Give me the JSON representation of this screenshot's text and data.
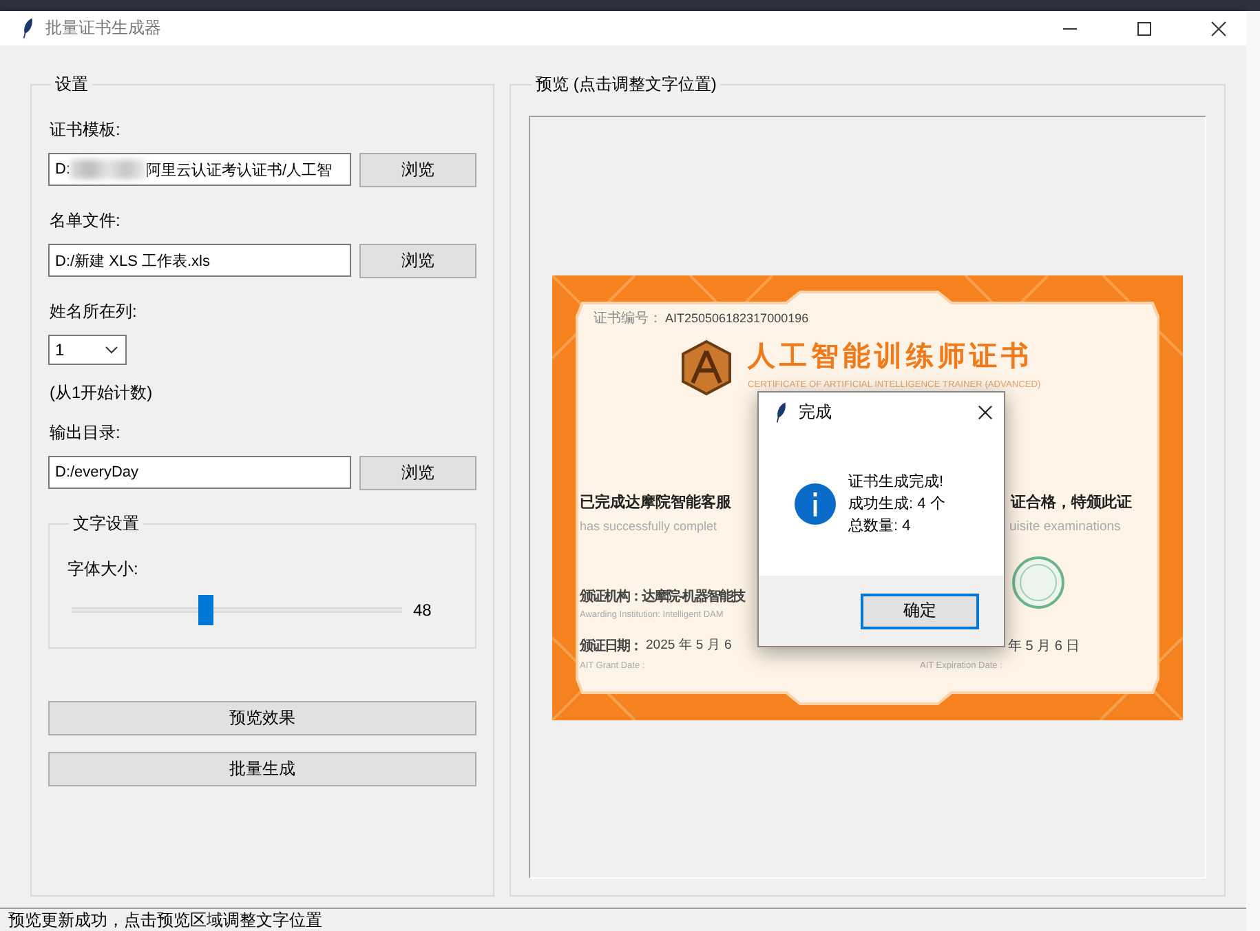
{
  "window": {
    "title": "批量证书生成器"
  },
  "settings": {
    "title": "设置",
    "fields": [
      {
        "kind": "path",
        "label": "证书模板:",
        "value": "D:",
        "value_after_redaction": "阿里云认证考认证书/人工智",
        "button": "浏览"
      },
      {
        "kind": "path",
        "label": "名单文件:",
        "value": "D:/新建 XLS 工作表.xls",
        "button": "浏览"
      },
      {
        "kind": "combo",
        "label": "姓名所在列:",
        "value": "1",
        "hint": "(从1开始计数)"
      },
      {
        "kind": "path",
        "label": "输出目录:",
        "value": "D:/everyDay",
        "button": "浏览"
      }
    ],
    "text_settings": {
      "title": "文字设置",
      "label": "字体大小:",
      "level": 0.41,
      "reading": "48"
    },
    "actions": [
      "预览效果",
      "批量生成"
    ]
  },
  "preview": {
    "title": "预览 (点击调整文字位置)",
    "certificate": {
      "number_label": "证书编号：",
      "number": "AIT250506182317000196",
      "title": "人工智能训练师证书",
      "subtitle": "CERTIFICATE OF ARTIFICIAL INTELLIGENCE TRAINER (ADVANCED)",
      "statement_left": "已完成达摩院智能客服",
      "statement_right": "证合格，特颁此证",
      "statement_en_left": "has successfully complet",
      "statement_en_right": "uisite examinations",
      "issuer": "颁证机构：达摩院-机器智能技",
      "issuer_en": "Awarding Institution: Intelligent DAM",
      "grant_label": "颁证日期：",
      "grant_date": "2025 年 5 月 6",
      "grant_en": "AIT Grant Date :",
      "expiry_date": "年 5 月 6 日",
      "expiry_en": "AIT Expiration Date :"
    }
  },
  "dialog": {
    "title": "完成",
    "lines": [
      "证书生成完成!",
      "成功生成: 4 个",
      "总数量: 4"
    ],
    "button": "确定"
  },
  "status_bar": "预览更新成功，点击预览区域调整文字位置"
}
